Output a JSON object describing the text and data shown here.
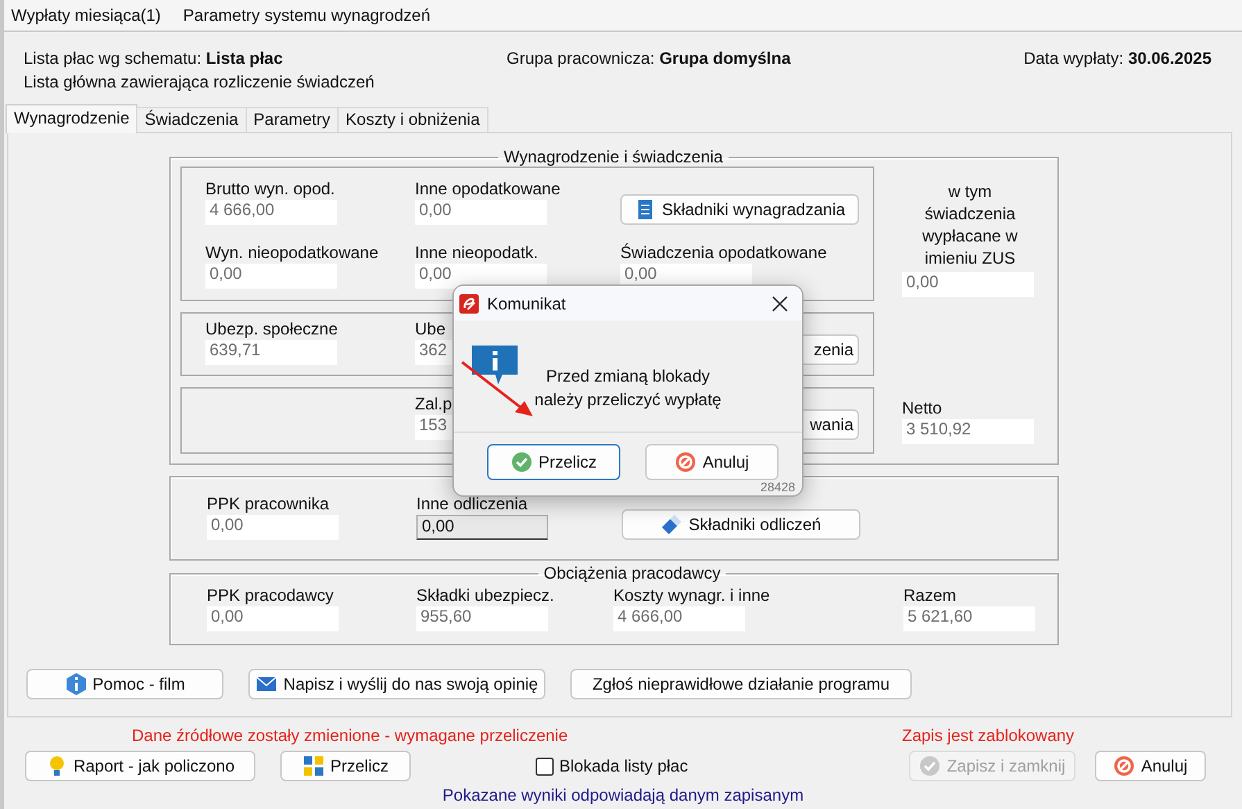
{
  "menu": [
    {
      "label": "Wypłaty miesiąca(1)"
    },
    {
      "label": "Parametry systemu wynagrodzeń"
    }
  ],
  "header": {
    "schema": "Lista płac wg schematu: **Lista płac**",
    "group": "Grupa pracownicza: **Grupa domyślna**",
    "date": "Data wypłaty: **30.06.2025**",
    "description": "Lista główna zawierająca rozliczenie świadczeń"
  },
  "tabs": [
    {
      "label": "Wynagrodzenie",
      "selected": true
    },
    {
      "label": "Świadczenia",
      "selected": false
    },
    {
      "label": "Parametry",
      "selected": false
    },
    {
      "label": "Koszty i obniżenia",
      "selected": false
    }
  ],
  "salary_group": {
    "title": "Wynagrodzenie i świadczenia",
    "sections": [
      {
        "items": [
          {
            "kind": "field",
            "label": "Brutto wyn. opod.",
            "value": "4 666,00",
            "editable": false
          },
          {
            "kind": "field",
            "label": "Inne opodatkowane",
            "value": "0,00",
            "editable": false
          },
          {
            "kind": "button",
            "label": "Składniki wynagradzania"
          },
          {
            "kind": "field",
            "label": "Wyn. nieopodatkowane",
            "value": "0,00",
            "editable": false
          },
          {
            "kind": "field",
            "label": "Inne nieopodatk.",
            "value": "0,00",
            "editable": false
          },
          {
            "kind": "field",
            "label": "Świadczenia opodatkowane",
            "value": "0,00",
            "editable": false
          }
        ]
      },
      {
        "items": [
          {
            "kind": "field",
            "label": "Ubezp. społeczne",
            "value": "639,71",
            "editable": false
          },
          {
            "kind": "field",
            "label": "Ube",
            "value": "362",
            "editable": false
          },
          {
            "kind": "button",
            "label": "zenia"
          }
        ]
      },
      {
        "items": [
          {
            "kind": "field",
            "label": "Zal.p",
            "value": "153",
            "editable": false
          },
          {
            "kind": "button",
            "label": "wania"
          }
        ]
      }
    ],
    "zus": {
      "label": "w tym świadczenia wypłacane w imieniu ZUS",
      "value": "0,00",
      "editable": false
    },
    "netto": {
      "label": "Netto",
      "value": "3 510,92",
      "editable": false
    }
  },
  "deductions_group": {
    "items": [
      {
        "kind": "field",
        "label": "PPK pracownika",
        "value": "0,00",
        "editable": false
      },
      {
        "kind": "field",
        "label": "Inne odliczenia",
        "value": "0,00",
        "editable": true
      },
      {
        "kind": "button",
        "label": "Składniki odliczeń"
      }
    ]
  },
  "employer_group": {
    "title": "Obciążenia pracodawcy",
    "items": [
      {
        "kind": "field",
        "label": "PPK pracodawcy",
        "value": "0,00",
        "editable": false
      },
      {
        "kind": "field",
        "label": "Składki ubezpiecz.",
        "value": "955,60",
        "editable": false
      },
      {
        "kind": "field",
        "label": "Koszty wynagr. i inne",
        "value": "4 666,00",
        "editable": false
      },
      {
        "kind": "field",
        "label": "Razem",
        "value": "5 621,60",
        "editable": false
      }
    ]
  },
  "action_buttons": [
    {
      "label": "Pomoc - film"
    },
    {
      "label": "Napisz i wyślij do nas swoją opinię"
    },
    {
      "label": "Zgłoś nieprawidłowe działanie programu"
    }
  ],
  "footer": {
    "warning_left": "Dane źródłowe zostały zmienione - wymagane przeliczenie",
    "warning_right": "Zapis jest zablokowany",
    "controls": [
      {
        "kind": "button",
        "label": "Raport - jak policzono",
        "disabled": false
      },
      {
        "kind": "button",
        "label": "Przelicz",
        "disabled": false
      },
      {
        "kind": "checkbox",
        "label": "Blokada listy płac",
        "checked": false
      },
      {
        "kind": "button",
        "label": "Zapisz i zamknij",
        "disabled": true
      },
      {
        "kind": "button",
        "label": "Anuluj",
        "disabled": false
      }
    ],
    "status": "Pokazane wyniki odpowiadają danym zapisanym"
  },
  "dialog": {
    "title": "Komunikat",
    "message": "Przed zmianą blokady\nnależy przeliczyć wypłatę",
    "buttons": [
      {
        "label": "Przelicz",
        "default": true
      },
      {
        "label": "Anuluj",
        "default": false
      }
    ],
    "code": "28428"
  }
}
